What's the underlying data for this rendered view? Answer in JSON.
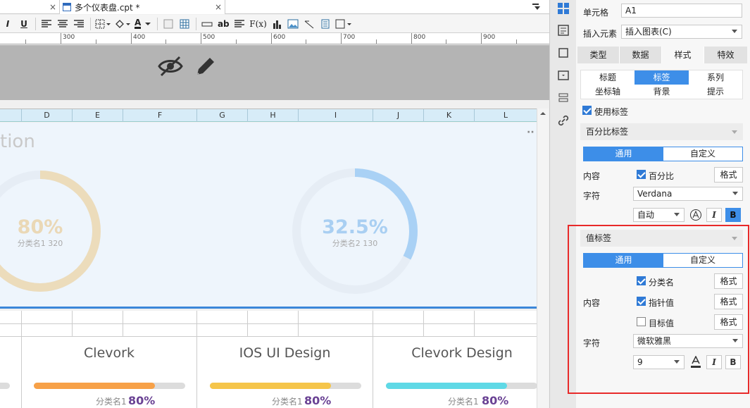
{
  "tabs": {
    "close1": "×",
    "doc_title": "多个仪表盘.cpt *",
    "close2": "×"
  },
  "toolbar": {
    "italic": "I",
    "underline": "U",
    "font_color_letter": "A",
    "ab": "ab",
    "fx": "F(x)"
  },
  "ruler": {
    "ticks": [
      "300",
      "400",
      "500",
      "600",
      "700",
      "800",
      "900"
    ]
  },
  "columns": [
    "D",
    "E",
    "F",
    "G",
    "H",
    "I",
    "J",
    "K",
    "L"
  ],
  "chart": {
    "title_partial": "tion",
    "more": "··",
    "gauges": [
      {
        "value_label": "80%",
        "sub_label": "分类名1 320",
        "fraction": 0.8,
        "color": "#ecdcbb",
        "text_color": "#ead8b6"
      },
      {
        "value_label": "32.5%",
        "sub_label": "分类名2 130",
        "fraction": 0.325,
        "color": "#a9d1f5",
        "text_color": "#a9cff2"
      }
    ]
  },
  "cards": [
    {
      "title": "Clevork",
      "category": "分类名1",
      "percent": "80%",
      "fraction": 0.8,
      "color": "#f7a148"
    },
    {
      "title": "IOS UI Design",
      "category": "分类名1",
      "percent": "80%",
      "fraction": 0.8,
      "color": "#f5c54a"
    },
    {
      "title": "Clevork Design",
      "category": "分类名1",
      "percent": "80%",
      "fraction": 0.8,
      "color": "#5fd9e6"
    }
  ],
  "panel": {
    "cell_label": "单元格",
    "cell_value": "A1",
    "insert_label": "插入元素",
    "insert_value": "插入图表(C)",
    "main_tabs": [
      "类型",
      "数据",
      "样式",
      "特效"
    ],
    "sub_tabs": [
      "标题",
      "标签",
      "系列",
      "坐标轴",
      "背景",
      "提示"
    ],
    "use_label": "使用标签",
    "percent_section": "百分比标签",
    "seg_general": "通用",
    "seg_custom": "自定义",
    "content_label": "内容",
    "percent_check": "百分比",
    "format": "格式",
    "char_label": "字符",
    "font_value": "Verdana",
    "size_value": "自动",
    "bold": "B",
    "italic": "I",
    "value_section": "值标签",
    "cat_check": "分类名",
    "pointer_check": "指针值",
    "target_check": "目标值",
    "font2_value": "微软雅黑",
    "size2_value": "9"
  }
}
